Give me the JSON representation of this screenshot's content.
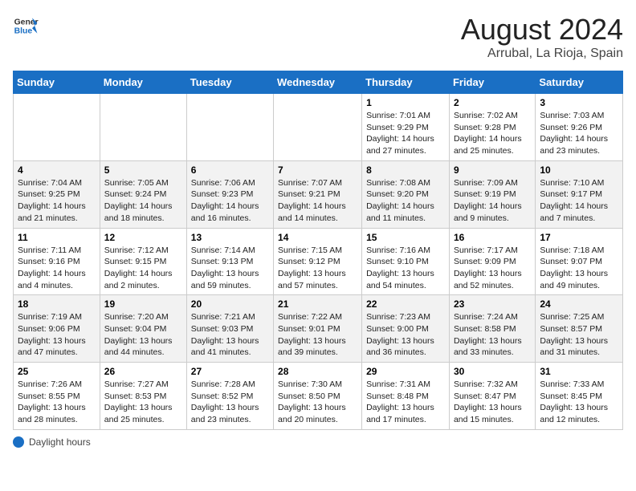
{
  "header": {
    "logo_line1": "General",
    "logo_line2": "Blue",
    "main_title": "August 2024",
    "subtitle": "Arrubal, La Rioja, Spain"
  },
  "days_of_week": [
    "Sunday",
    "Monday",
    "Tuesday",
    "Wednesday",
    "Thursday",
    "Friday",
    "Saturday"
  ],
  "weeks": [
    [
      {
        "day": "",
        "info": ""
      },
      {
        "day": "",
        "info": ""
      },
      {
        "day": "",
        "info": ""
      },
      {
        "day": "",
        "info": ""
      },
      {
        "day": "1",
        "info": "Sunrise: 7:01 AM\nSunset: 9:29 PM\nDaylight: 14 hours and 27 minutes."
      },
      {
        "day": "2",
        "info": "Sunrise: 7:02 AM\nSunset: 9:28 PM\nDaylight: 14 hours and 25 minutes."
      },
      {
        "day": "3",
        "info": "Sunrise: 7:03 AM\nSunset: 9:26 PM\nDaylight: 14 hours and 23 minutes."
      }
    ],
    [
      {
        "day": "4",
        "info": "Sunrise: 7:04 AM\nSunset: 9:25 PM\nDaylight: 14 hours and 21 minutes."
      },
      {
        "day": "5",
        "info": "Sunrise: 7:05 AM\nSunset: 9:24 PM\nDaylight: 14 hours and 18 minutes."
      },
      {
        "day": "6",
        "info": "Sunrise: 7:06 AM\nSunset: 9:23 PM\nDaylight: 14 hours and 16 minutes."
      },
      {
        "day": "7",
        "info": "Sunrise: 7:07 AM\nSunset: 9:21 PM\nDaylight: 14 hours and 14 minutes."
      },
      {
        "day": "8",
        "info": "Sunrise: 7:08 AM\nSunset: 9:20 PM\nDaylight: 14 hours and 11 minutes."
      },
      {
        "day": "9",
        "info": "Sunrise: 7:09 AM\nSunset: 9:19 PM\nDaylight: 14 hours and 9 minutes."
      },
      {
        "day": "10",
        "info": "Sunrise: 7:10 AM\nSunset: 9:17 PM\nDaylight: 14 hours and 7 minutes."
      }
    ],
    [
      {
        "day": "11",
        "info": "Sunrise: 7:11 AM\nSunset: 9:16 PM\nDaylight: 14 hours and 4 minutes."
      },
      {
        "day": "12",
        "info": "Sunrise: 7:12 AM\nSunset: 9:15 PM\nDaylight: 14 hours and 2 minutes."
      },
      {
        "day": "13",
        "info": "Sunrise: 7:14 AM\nSunset: 9:13 PM\nDaylight: 13 hours and 59 minutes."
      },
      {
        "day": "14",
        "info": "Sunrise: 7:15 AM\nSunset: 9:12 PM\nDaylight: 13 hours and 57 minutes."
      },
      {
        "day": "15",
        "info": "Sunrise: 7:16 AM\nSunset: 9:10 PM\nDaylight: 13 hours and 54 minutes."
      },
      {
        "day": "16",
        "info": "Sunrise: 7:17 AM\nSunset: 9:09 PM\nDaylight: 13 hours and 52 minutes."
      },
      {
        "day": "17",
        "info": "Sunrise: 7:18 AM\nSunset: 9:07 PM\nDaylight: 13 hours and 49 minutes."
      }
    ],
    [
      {
        "day": "18",
        "info": "Sunrise: 7:19 AM\nSunset: 9:06 PM\nDaylight: 13 hours and 47 minutes."
      },
      {
        "day": "19",
        "info": "Sunrise: 7:20 AM\nSunset: 9:04 PM\nDaylight: 13 hours and 44 minutes."
      },
      {
        "day": "20",
        "info": "Sunrise: 7:21 AM\nSunset: 9:03 PM\nDaylight: 13 hours and 41 minutes."
      },
      {
        "day": "21",
        "info": "Sunrise: 7:22 AM\nSunset: 9:01 PM\nDaylight: 13 hours and 39 minutes."
      },
      {
        "day": "22",
        "info": "Sunrise: 7:23 AM\nSunset: 9:00 PM\nDaylight: 13 hours and 36 minutes."
      },
      {
        "day": "23",
        "info": "Sunrise: 7:24 AM\nSunset: 8:58 PM\nDaylight: 13 hours and 33 minutes."
      },
      {
        "day": "24",
        "info": "Sunrise: 7:25 AM\nSunset: 8:57 PM\nDaylight: 13 hours and 31 minutes."
      }
    ],
    [
      {
        "day": "25",
        "info": "Sunrise: 7:26 AM\nSunset: 8:55 PM\nDaylight: 13 hours and 28 minutes."
      },
      {
        "day": "26",
        "info": "Sunrise: 7:27 AM\nSunset: 8:53 PM\nDaylight: 13 hours and 25 minutes."
      },
      {
        "day": "27",
        "info": "Sunrise: 7:28 AM\nSunset: 8:52 PM\nDaylight: 13 hours and 23 minutes."
      },
      {
        "day": "28",
        "info": "Sunrise: 7:30 AM\nSunset: 8:50 PM\nDaylight: 13 hours and 20 minutes."
      },
      {
        "day": "29",
        "info": "Sunrise: 7:31 AM\nSunset: 8:48 PM\nDaylight: 13 hours and 17 minutes."
      },
      {
        "day": "30",
        "info": "Sunrise: 7:32 AM\nSunset: 8:47 PM\nDaylight: 13 hours and 15 minutes."
      },
      {
        "day": "31",
        "info": "Sunrise: 7:33 AM\nSunset: 8:45 PM\nDaylight: 13 hours and 12 minutes."
      }
    ]
  ],
  "footer": {
    "label": "Daylight hours"
  }
}
